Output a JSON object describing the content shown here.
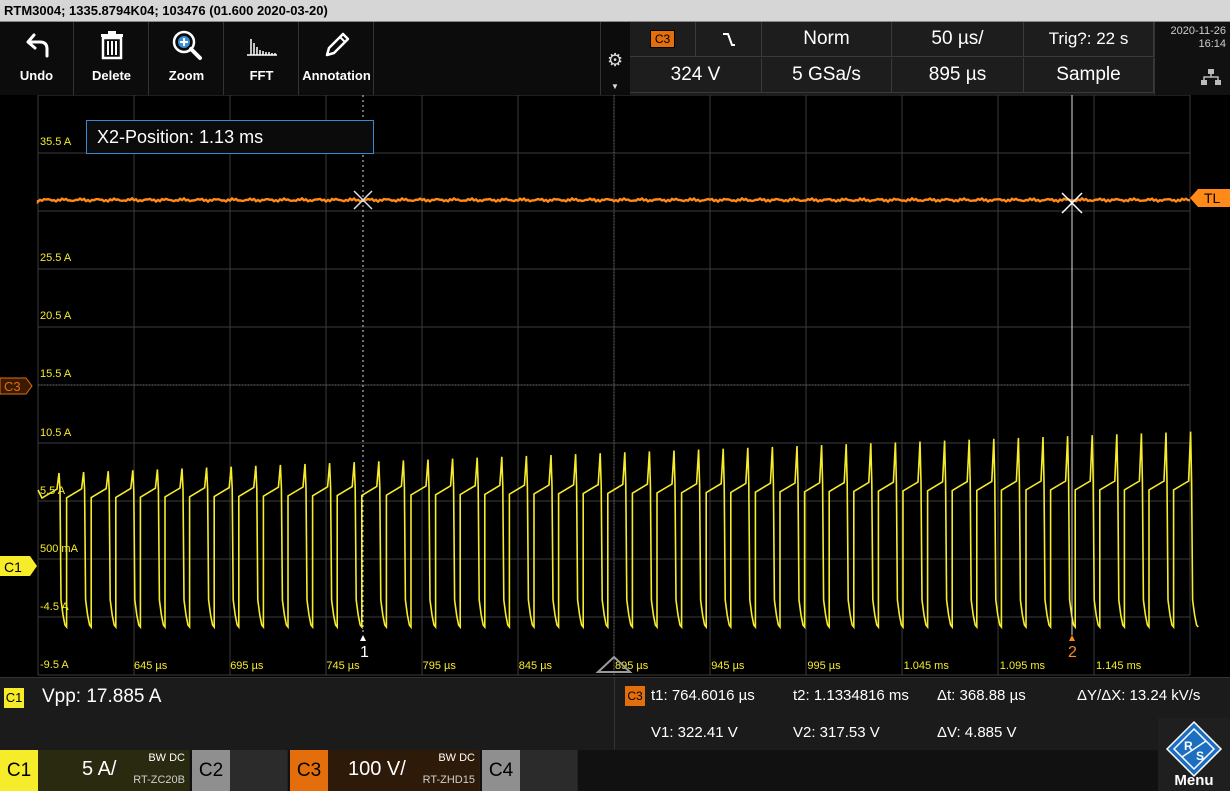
{
  "title": "RTM3004; 1335.8794K04; 103476 (01.600 2020-03-20)",
  "toolbar": [
    {
      "label": "Undo",
      "icon": "undo-icon"
    },
    {
      "label": "Delete",
      "icon": "trash-icon"
    },
    {
      "label": "Zoom",
      "icon": "zoom-icon"
    },
    {
      "label": "FFT",
      "icon": "fft-icon"
    },
    {
      "label": "Annotation",
      "icon": "pencil-icon"
    }
  ],
  "settings": {
    "trigger_source": "C3",
    "slope_icon": "falling-edge-icon",
    "trigger_mode": "Norm",
    "timebase": "50 µs/",
    "trig_status": "Trig?: 22 s",
    "trigger_level": "324 V",
    "sample_rate": "5 GSa/s",
    "record_length": "895 µs",
    "acq_mode": "Sample"
  },
  "datetime": {
    "date": "2020-11-26",
    "time": "16:14"
  },
  "plot": {
    "tooltip": "X2-Position: 1.13 ms",
    "y_labels": [
      "35.5 A",
      "25.5 A",
      "20.5 A",
      "15.5 A",
      "10.5 A",
      "5.5 A",
      "500 mA",
      "-4.5 A",
      "-9.5 A"
    ],
    "x_labels": [
      "645 µs",
      "695 µs",
      "745 µs",
      "795 µs",
      "845 µs",
      "895 µs",
      "945 µs",
      "995 µs",
      "1.045 ms",
      "1.095 ms",
      "1.145 ms"
    ],
    "markers": {
      "c3": "C3",
      "c1": "C1",
      "tl": "TL",
      "cursor1": "1",
      "cursor2": "2"
    },
    "colors": {
      "c1": "#f6ec2a",
      "c3": "#ff8a1a",
      "grid": "#3c3c3c"
    }
  },
  "measure": {
    "chip": "C1",
    "vpp": "Vpp: 17.885 A",
    "cursor_chip": "C3",
    "t1": "t1: 764.6016 µs",
    "t2": "t2: 1.1334816 ms",
    "dt": "Δt: 368.88 µs",
    "slope": "ΔY/ΔX: 13.24 kV/s",
    "v1": "V1: 322.41 V",
    "v2": "V2: 317.53 V",
    "dv": "ΔV: 4.885 V"
  },
  "channels": [
    {
      "name": "C1",
      "scale": "5 A/",
      "bw": "BW DC",
      "probe": "RT-ZC20B",
      "active": true,
      "color": "#f6ec2a"
    },
    {
      "name": "C2",
      "scale": "",
      "bw": "",
      "probe": "",
      "active": false,
      "color": "#9a9a9a"
    },
    {
      "name": "C3",
      "scale": "100 V/",
      "bw": "BW DC",
      "probe": "RT-ZHD15",
      "active": true,
      "color": "#e56e0c"
    },
    {
      "name": "C4",
      "scale": "",
      "bw": "",
      "probe": "",
      "active": false,
      "color": "#9a9a9a"
    }
  ],
  "menu_label": "Menu"
}
